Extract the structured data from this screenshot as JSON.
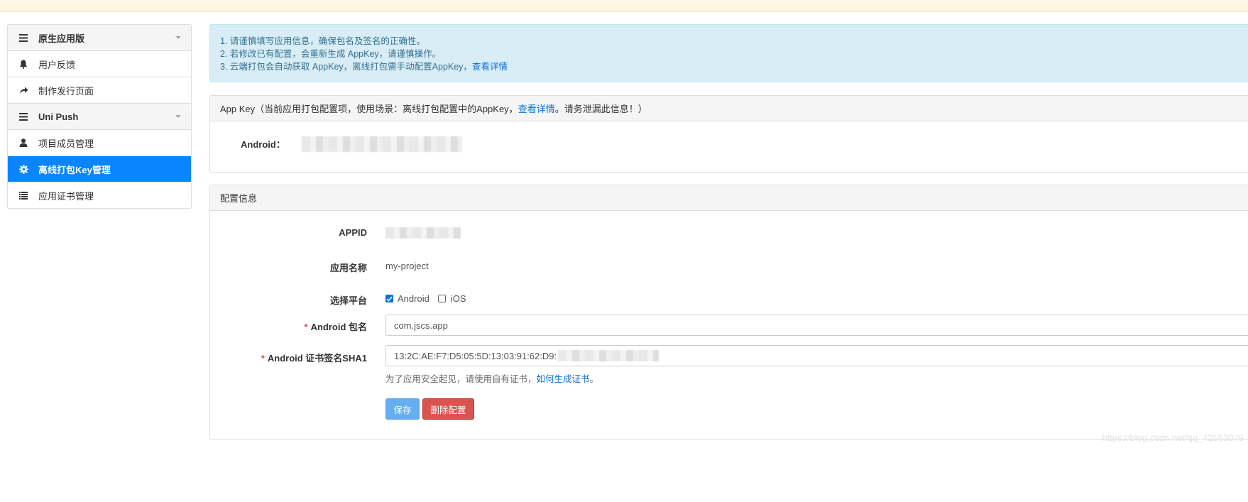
{
  "sidebar": {
    "items": [
      {
        "label": "原生应用版",
        "icon": "menu-icon",
        "group": true
      },
      {
        "label": "用户反馈",
        "icon": "bell-icon"
      },
      {
        "label": "制作发行页面",
        "icon": "share-icon"
      },
      {
        "label": "Uni Push",
        "icon": "menu-icon",
        "group": true
      },
      {
        "label": "项目成员管理",
        "icon": "user-icon"
      },
      {
        "label": "离线打包Key管理",
        "icon": "gear-icon",
        "active": true
      },
      {
        "label": "应用证书管理",
        "icon": "list-icon"
      }
    ]
  },
  "alert": {
    "line1": "1. 请谨慎填写应用信息，确保包名及签名的正确性。",
    "line2": "2. 若修改已有配置，会重新生成 AppKey，请谨慎操作。",
    "line3": "3. 云端打包会自动获取 AppKey，离线打包需手动配置AppKey，",
    "line3_link": "查看详情"
  },
  "appkey_panel": {
    "heading_prefix": "App Key（当前应用打包配置项，使用场景：离线打包配置中的AppKey，",
    "heading_link": "查看详情",
    "heading_suffix": "。请务泄漏此信息！）",
    "android_label": "Android："
  },
  "config_panel": {
    "heading": "配置信息",
    "appid_label": "APPID",
    "name_label": "应用名称",
    "name_value": "my-project",
    "platform_label": "选择平台",
    "platform_android": "Android",
    "platform_ios": "iOS",
    "android_checked": true,
    "ios_checked": false,
    "required_mark": "*",
    "package_label": "Android 包名",
    "package_value": "com.jscs.app",
    "sha1_label": "Android 证书签名SHA1",
    "sha1_value": "13:2C:AE:F7:D5:05:5D:13:03:91:62:D9:",
    "hint_text": "为了应用安全起见，请使用自有证书，",
    "hint_link": "如何生成证书",
    "hint_end": "。",
    "save_button": "保存",
    "delete_button": "删除配置"
  },
  "watermark": "https://blog.csdn.net/qq_42563079",
  "colors": {
    "active": "#0a84ff",
    "alert_bg": "#d9edf7",
    "link": "#0a6fd8",
    "save": "#66aef2",
    "delete": "#d9534f"
  }
}
